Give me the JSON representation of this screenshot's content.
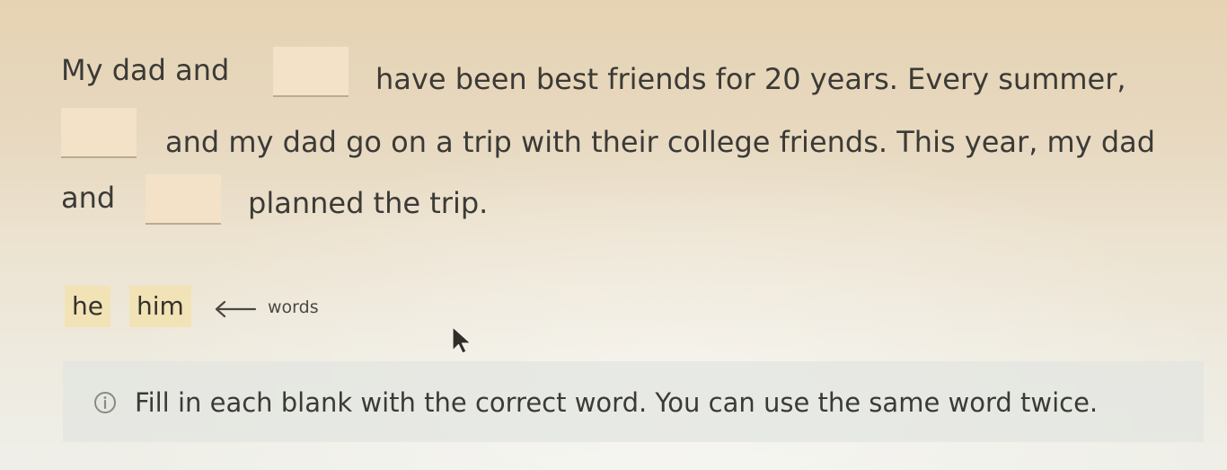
{
  "passage": {
    "line1_start": "My dad and",
    "line1_end": "have been best friends for 20 years. Every summer,",
    "line2_end": "and my dad go on a trip with their college friends. This year, my dad",
    "line3_start": "and",
    "line3_end": "planned the trip."
  },
  "blanks": [
    {
      "value": ""
    },
    {
      "value": ""
    },
    {
      "value": ""
    }
  ],
  "word_bank": {
    "words": [
      "he",
      "him"
    ],
    "annotation": "words",
    "annotation_icon": "left-arrow-icon"
  },
  "hint": {
    "icon": "info-icon",
    "text": "Fill in each blank with the correct word. You can use the same word twice."
  },
  "colors": {
    "blank_fill": "#f3e2c8",
    "chip_fill": "#f2e3b6",
    "hint_background": "#e2e4e0",
    "text": "#3b3a36"
  }
}
